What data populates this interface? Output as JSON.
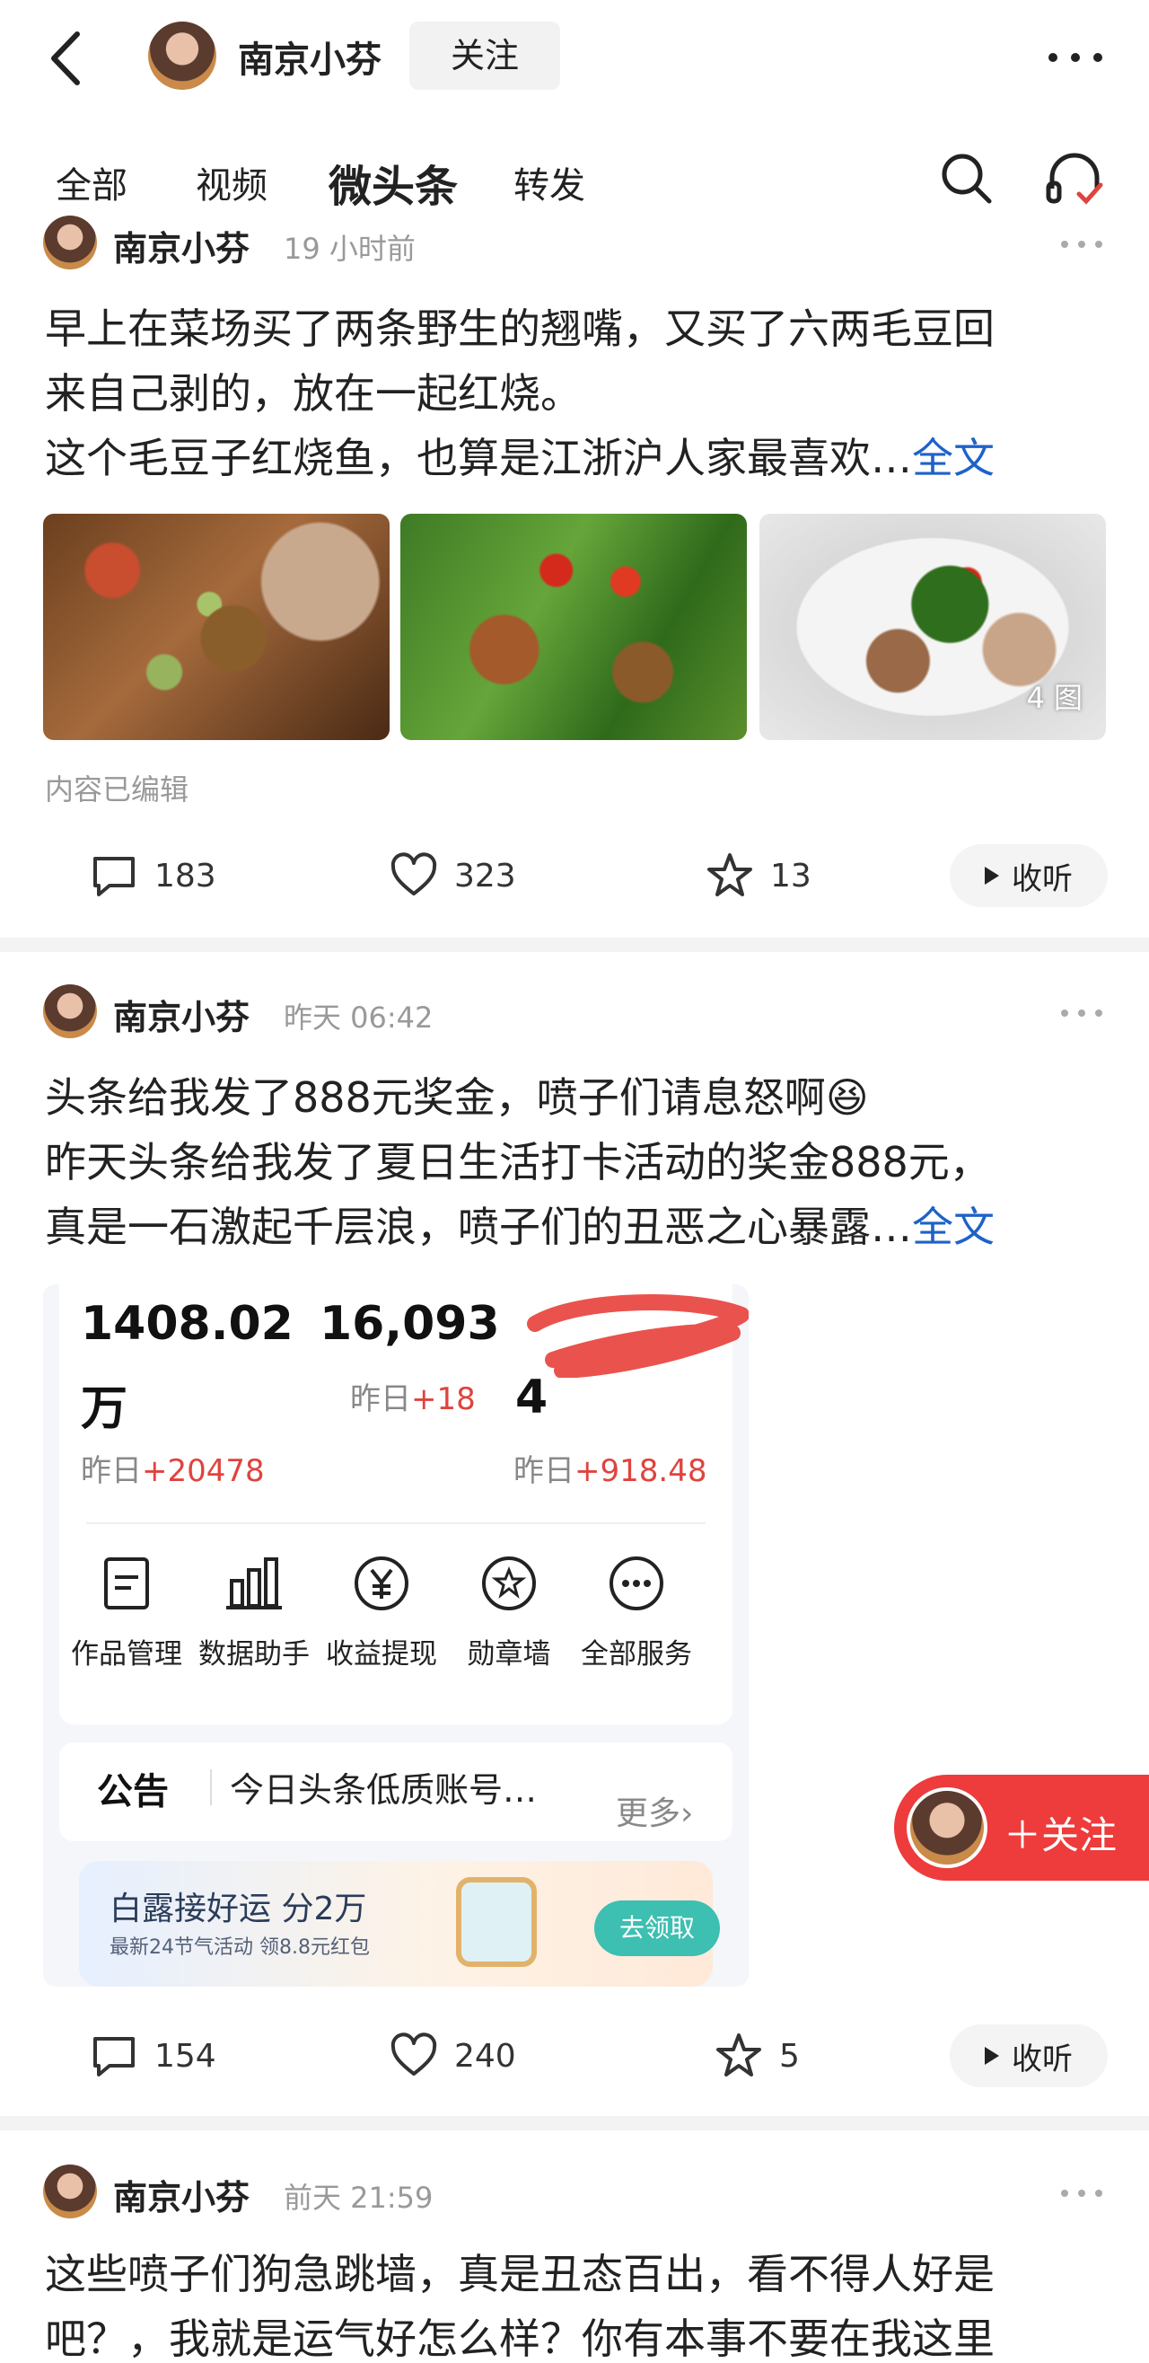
{
  "header": {
    "author_name": "南京小芬",
    "follow_label": "关注"
  },
  "tabs": [
    {
      "label": "全部"
    },
    {
      "label": "视频"
    },
    {
      "label": "微头条"
    },
    {
      "label": "转发"
    }
  ],
  "posts": [
    {
      "author": "南京小芬",
      "time": "19 小时前",
      "lines": [
        "早上在菜场买了两条野生的翘嘴，又买了六两毛豆回",
        "来自己剥的，放在一起红烧。",
        "这个毛豆子红烧鱼，也算是江浙沪人家最喜欢…"
      ],
      "fulltext": "全文",
      "image_count": "4 图",
      "edited": "内容已编辑",
      "comments": "183",
      "likes": "323",
      "favorites": "13",
      "listen": "收听"
    },
    {
      "author": "南京小芬",
      "time": "昨天 06:42",
      "lines": [
        "头条给我发了888元奖金，喷子们请息怒啊😆",
        "昨天头条给我发了夏日生活打卡活动的奖金888元，",
        "真是一石激起千层浪，喷子们的丑恶之心暴露…"
      ],
      "fulltext": "全文",
      "embedded": {
        "stat1_value_line1": "1408.02",
        "stat1_value_line2": "万",
        "stat1_yesterday_prefix": "昨日",
        "stat1_yesterday_delta": "+20478",
        "stat2_value": "16,093",
        "stat2_yesterday_prefix": "昨日",
        "stat2_yesterday_delta": "+18",
        "stat3_value_line2": "4",
        "stat3_yesterday_prefix": "昨日",
        "stat3_yesterday_delta": "+918.48",
        "services": [
          {
            "label": "作品管理",
            "icon": "document-icon"
          },
          {
            "label": "数据助手",
            "icon": "bar-chart-icon"
          },
          {
            "label": "收益提现",
            "icon": "yuan-icon"
          },
          {
            "label": "勋章墙",
            "icon": "medal-icon"
          },
          {
            "label": "全部服务",
            "icon": "more-icon"
          }
        ],
        "notice_label": "公告",
        "notice_text": "今日头条低质账号…",
        "notice_more": "更多›",
        "banner_title": "白露接好运  分2万",
        "banner_sub": "最新24节气活动 领8.8元红包",
        "banner_button": "去领取"
      },
      "comments": "154",
      "likes": "240",
      "favorites": "5",
      "listen": "收听"
    },
    {
      "author": "南京小芬",
      "time": "前天 21:59",
      "lines": [
        "这些喷子们狗急跳墙，真是丑态百出，看不得人好是",
        "吧？，我就是运气好怎么样？你有本事不要在我这里"
      ]
    }
  ],
  "float_follow_label": "＋关注",
  "colors": {
    "link_blue": "#1e62c8",
    "follow_red": "#ee3b3b",
    "up_red": "#e0433e"
  }
}
